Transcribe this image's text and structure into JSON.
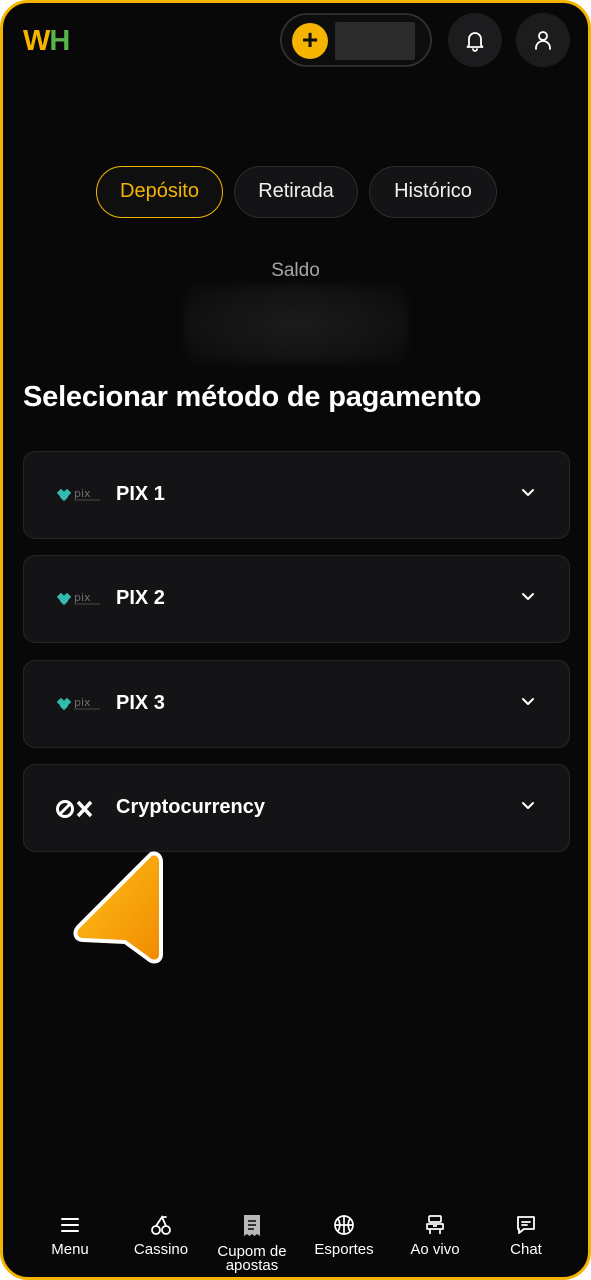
{
  "header": {
    "logo_w": "W",
    "logo_h": "H",
    "add_symbol": "+",
    "icons": {
      "add": "plus-icon",
      "notifications": "bell-icon",
      "profile": "user-icon"
    }
  },
  "tabs": [
    {
      "label": "Depósito",
      "active": true
    },
    {
      "label": "Retirada",
      "active": false
    },
    {
      "label": "Histórico",
      "active": false
    }
  ],
  "balance": {
    "label": "Saldo"
  },
  "section_title": "Selecionar método de pagamento",
  "methods": [
    {
      "label": "PIX 1",
      "logo": "pix-logo"
    },
    {
      "label": "PIX 2",
      "logo": "pix-logo"
    },
    {
      "label": "PIX 3",
      "logo": "pix-logo"
    },
    {
      "label": "Cryptocurrency",
      "logo": "0x-logo",
      "logo_text": "0X"
    }
  ],
  "bottom_nav": [
    {
      "label": "Menu",
      "icon": "menu-icon"
    },
    {
      "label": "Cassino",
      "icon": "cherries-icon"
    },
    {
      "label": "Cupom de apostas",
      "icon": "receipt-icon"
    },
    {
      "label": "Esportes",
      "icon": "basketball-icon"
    },
    {
      "label": "Ao vivo",
      "icon": "live-icon"
    },
    {
      "label": "Chat",
      "icon": "chat-icon"
    }
  ],
  "colors": {
    "accent": "#f5b400",
    "logo_green": "#59b34a",
    "pix_teal": "#32bcad",
    "background": "#080808",
    "card": "#141416"
  }
}
